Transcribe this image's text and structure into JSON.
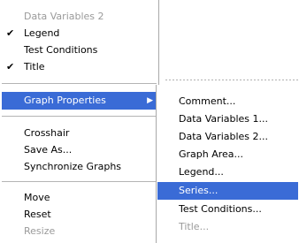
{
  "main_menu": {
    "items": [
      {
        "label": "Data Variables 2",
        "checked": false,
        "disabled": true
      },
      {
        "label": "Legend",
        "checked": true,
        "disabled": false
      },
      {
        "label": "Test Conditions",
        "checked": false,
        "disabled": false
      },
      {
        "label": "Title",
        "checked": true,
        "disabled": false
      },
      {
        "label": "Graph Properties",
        "has_submenu": true,
        "highlighted": true
      },
      {
        "label": "Crosshair"
      },
      {
        "label": "Save As..."
      },
      {
        "label": "Synchronize Graphs"
      },
      {
        "label": "Move"
      },
      {
        "label": "Reset"
      },
      {
        "label": "Resize",
        "disabled": true
      }
    ],
    "check_glyph": "✔",
    "submenu_arrow_glyph": "▶"
  },
  "sub_menu": {
    "items": [
      {
        "label": "Comment..."
      },
      {
        "label": "Data Variables 1..."
      },
      {
        "label": "Data Variables 2..."
      },
      {
        "label": "Graph Area..."
      },
      {
        "label": "Legend..."
      },
      {
        "label": "Series...",
        "highlighted": true
      },
      {
        "label": "Test Conditions..."
      },
      {
        "label": "Title...",
        "disabled": true
      }
    ]
  },
  "colors": {
    "highlight": "#3a6bd6",
    "disabled_text": "#9a9a9a",
    "separator": "#b4b4b4"
  }
}
